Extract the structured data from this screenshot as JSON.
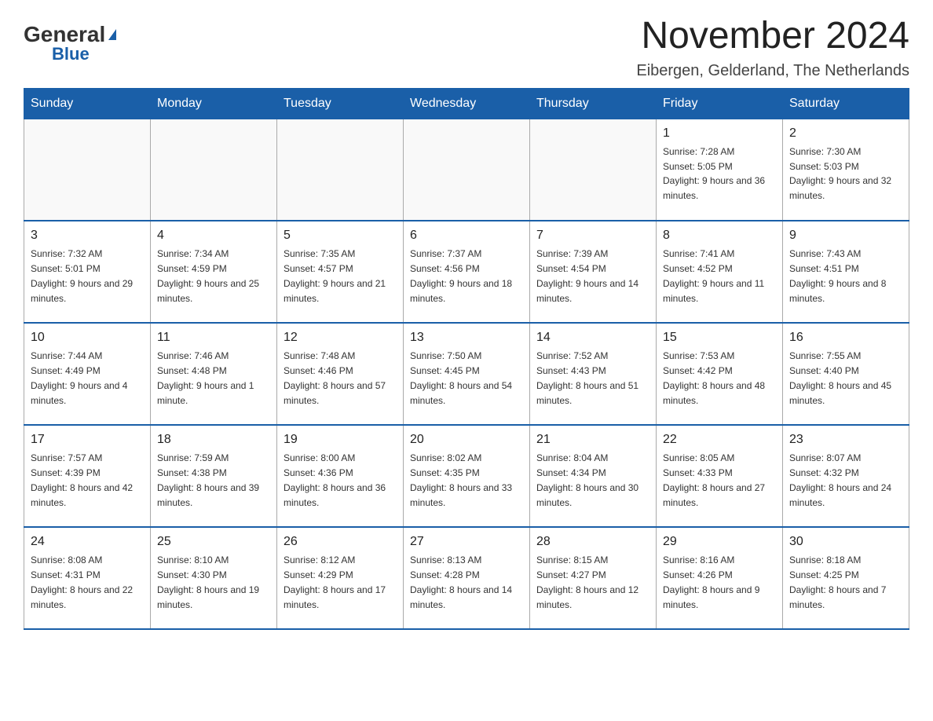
{
  "header": {
    "logo_general": "General",
    "logo_blue": "Blue",
    "title": "November 2024",
    "subtitle": "Eibergen, Gelderland, The Netherlands"
  },
  "days_of_week": [
    "Sunday",
    "Monday",
    "Tuesday",
    "Wednesday",
    "Thursday",
    "Friday",
    "Saturday"
  ],
  "weeks": [
    [
      {
        "day": "",
        "info": ""
      },
      {
        "day": "",
        "info": ""
      },
      {
        "day": "",
        "info": ""
      },
      {
        "day": "",
        "info": ""
      },
      {
        "day": "",
        "info": ""
      },
      {
        "day": "1",
        "info": "Sunrise: 7:28 AM\nSunset: 5:05 PM\nDaylight: 9 hours and 36 minutes."
      },
      {
        "day": "2",
        "info": "Sunrise: 7:30 AM\nSunset: 5:03 PM\nDaylight: 9 hours and 32 minutes."
      }
    ],
    [
      {
        "day": "3",
        "info": "Sunrise: 7:32 AM\nSunset: 5:01 PM\nDaylight: 9 hours and 29 minutes."
      },
      {
        "day": "4",
        "info": "Sunrise: 7:34 AM\nSunset: 4:59 PM\nDaylight: 9 hours and 25 minutes."
      },
      {
        "day": "5",
        "info": "Sunrise: 7:35 AM\nSunset: 4:57 PM\nDaylight: 9 hours and 21 minutes."
      },
      {
        "day": "6",
        "info": "Sunrise: 7:37 AM\nSunset: 4:56 PM\nDaylight: 9 hours and 18 minutes."
      },
      {
        "day": "7",
        "info": "Sunrise: 7:39 AM\nSunset: 4:54 PM\nDaylight: 9 hours and 14 minutes."
      },
      {
        "day": "8",
        "info": "Sunrise: 7:41 AM\nSunset: 4:52 PM\nDaylight: 9 hours and 11 minutes."
      },
      {
        "day": "9",
        "info": "Sunrise: 7:43 AM\nSunset: 4:51 PM\nDaylight: 9 hours and 8 minutes."
      }
    ],
    [
      {
        "day": "10",
        "info": "Sunrise: 7:44 AM\nSunset: 4:49 PM\nDaylight: 9 hours and 4 minutes."
      },
      {
        "day": "11",
        "info": "Sunrise: 7:46 AM\nSunset: 4:48 PM\nDaylight: 9 hours and 1 minute."
      },
      {
        "day": "12",
        "info": "Sunrise: 7:48 AM\nSunset: 4:46 PM\nDaylight: 8 hours and 57 minutes."
      },
      {
        "day": "13",
        "info": "Sunrise: 7:50 AM\nSunset: 4:45 PM\nDaylight: 8 hours and 54 minutes."
      },
      {
        "day": "14",
        "info": "Sunrise: 7:52 AM\nSunset: 4:43 PM\nDaylight: 8 hours and 51 minutes."
      },
      {
        "day": "15",
        "info": "Sunrise: 7:53 AM\nSunset: 4:42 PM\nDaylight: 8 hours and 48 minutes."
      },
      {
        "day": "16",
        "info": "Sunrise: 7:55 AM\nSunset: 4:40 PM\nDaylight: 8 hours and 45 minutes."
      }
    ],
    [
      {
        "day": "17",
        "info": "Sunrise: 7:57 AM\nSunset: 4:39 PM\nDaylight: 8 hours and 42 minutes."
      },
      {
        "day": "18",
        "info": "Sunrise: 7:59 AM\nSunset: 4:38 PM\nDaylight: 8 hours and 39 minutes."
      },
      {
        "day": "19",
        "info": "Sunrise: 8:00 AM\nSunset: 4:36 PM\nDaylight: 8 hours and 36 minutes."
      },
      {
        "day": "20",
        "info": "Sunrise: 8:02 AM\nSunset: 4:35 PM\nDaylight: 8 hours and 33 minutes."
      },
      {
        "day": "21",
        "info": "Sunrise: 8:04 AM\nSunset: 4:34 PM\nDaylight: 8 hours and 30 minutes."
      },
      {
        "day": "22",
        "info": "Sunrise: 8:05 AM\nSunset: 4:33 PM\nDaylight: 8 hours and 27 minutes."
      },
      {
        "day": "23",
        "info": "Sunrise: 8:07 AM\nSunset: 4:32 PM\nDaylight: 8 hours and 24 minutes."
      }
    ],
    [
      {
        "day": "24",
        "info": "Sunrise: 8:08 AM\nSunset: 4:31 PM\nDaylight: 8 hours and 22 minutes."
      },
      {
        "day": "25",
        "info": "Sunrise: 8:10 AM\nSunset: 4:30 PM\nDaylight: 8 hours and 19 minutes."
      },
      {
        "day": "26",
        "info": "Sunrise: 8:12 AM\nSunset: 4:29 PM\nDaylight: 8 hours and 17 minutes."
      },
      {
        "day": "27",
        "info": "Sunrise: 8:13 AM\nSunset: 4:28 PM\nDaylight: 8 hours and 14 minutes."
      },
      {
        "day": "28",
        "info": "Sunrise: 8:15 AM\nSunset: 4:27 PM\nDaylight: 8 hours and 12 minutes."
      },
      {
        "day": "29",
        "info": "Sunrise: 8:16 AM\nSunset: 4:26 PM\nDaylight: 8 hours and 9 minutes."
      },
      {
        "day": "30",
        "info": "Sunrise: 8:18 AM\nSunset: 4:25 PM\nDaylight: 8 hours and 7 minutes."
      }
    ]
  ]
}
